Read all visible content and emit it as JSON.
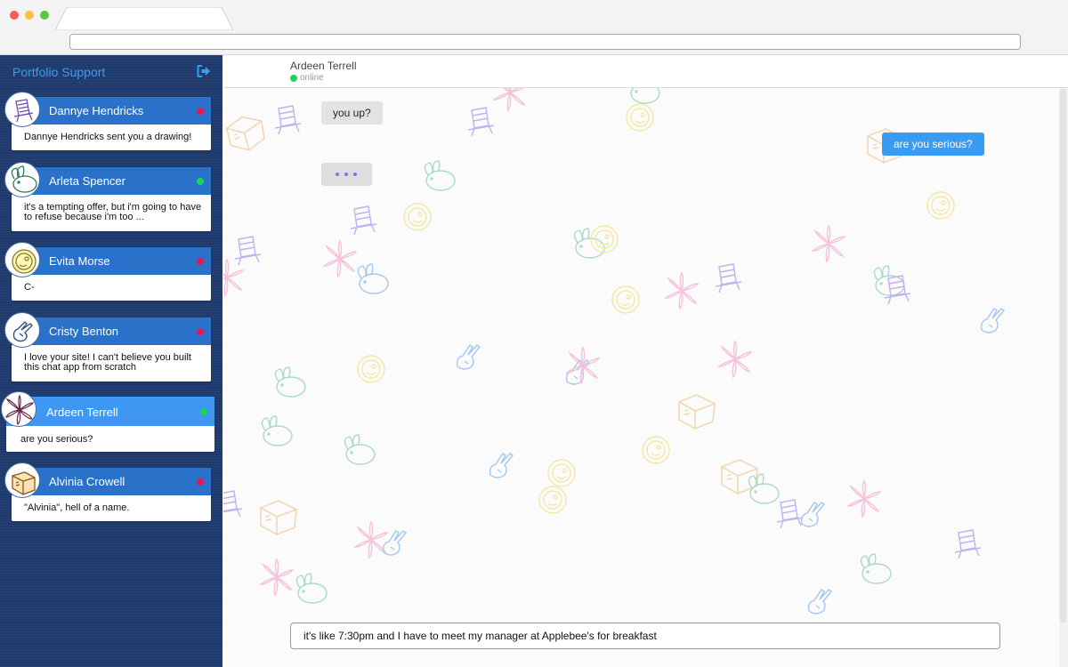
{
  "sidebar": {
    "title": "Portfolio Support",
    "logout_icon": "logout-icon",
    "conversations": [
      {
        "name": "Dannye Hendricks",
        "preview": "Dannye Hendricks sent you a drawing!",
        "status": "offline",
        "avatar": "lawn-chair-avatar"
      },
      {
        "name": "Arleta Spencer",
        "preview": "it's a tempting offer, but i'm going to have to refuse because i'm too ...",
        "status": "online",
        "avatar": "bunny-avatar"
      },
      {
        "name": "Evita Morse",
        "preview": "C-",
        "status": "offline",
        "avatar": "smiley-avatar"
      },
      {
        "name": "Cristy Benton",
        "preview": "I love your site! I can't believe you built this chat app from scratch",
        "status": "offline",
        "avatar": "peace-hand-avatar"
      },
      {
        "name": "Ardeen Terrell",
        "preview": "are you serious?",
        "status": "online",
        "avatar": "flower-avatar",
        "active": true
      },
      {
        "name": "Alvinia Crowell",
        "preview": "\"Alvinia\", hell of a name.",
        "status": "offline",
        "avatar": "box-avatar"
      }
    ]
  },
  "colors": {
    "online": "#1dd35a",
    "offline": "#e8184f",
    "header_blue": "#2a72c9",
    "active_blue": "#3e97f0",
    "sidebar_bg": "#1f3a6d"
  },
  "chat": {
    "contact_name": "Ardeen Terrell",
    "contact_status": "online",
    "messages": [
      {
        "from": "them",
        "text": "you up?"
      },
      {
        "from": "me",
        "text": "are you serious?"
      }
    ],
    "typing_indicator": "typing-dots-icon",
    "composer_value": "it's like 7:30pm and I have to meet my manager at Applebee's for breakfast"
  }
}
